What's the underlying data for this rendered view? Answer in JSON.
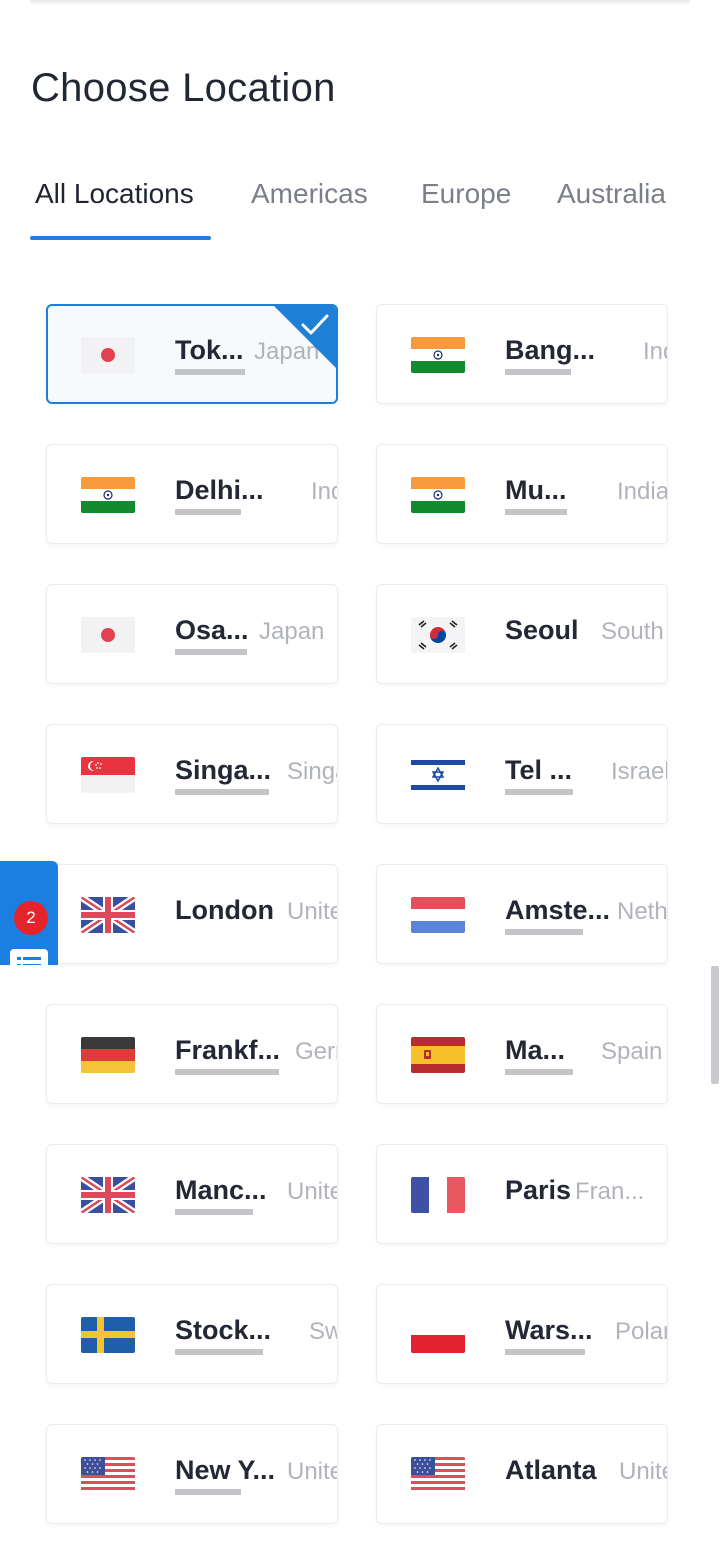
{
  "page": {
    "title": "Choose Location"
  },
  "tabs": [
    {
      "label": "All Locations",
      "active": true
    },
    {
      "label": "Americas",
      "active": false
    },
    {
      "label": "Europe",
      "active": false
    },
    {
      "label": "Australia",
      "active": false
    }
  ],
  "locations": [
    {
      "city": "Tok...",
      "country": "Japan",
      "flag": "japan-flag",
      "selected": true
    },
    {
      "city": "Bang...",
      "country": "India",
      "flag": "india-flag",
      "selected": false
    },
    {
      "city": "Delhi...",
      "country": "India",
      "flag": "india-flag",
      "selected": false
    },
    {
      "city": "Mu...",
      "country": "India",
      "flag": "india-flag",
      "selected": false
    },
    {
      "city": "Osa...",
      "country": "Japan",
      "flag": "japan-flag",
      "selected": false
    },
    {
      "city": "Seoul",
      "country": "South Korea",
      "flag": "south-korea-flag",
      "selected": false
    },
    {
      "city": "Singa...",
      "country": "Singapore",
      "flag": "singapore-flag",
      "selected": false
    },
    {
      "city": "Tel ...",
      "country": "Israel",
      "flag": "israel-flag",
      "selected": false
    },
    {
      "city": "London",
      "country": "United Kingdom",
      "flag": "uk-flag",
      "selected": false
    },
    {
      "city": "Amste...",
      "country": "Netherlands",
      "flag": "netherlands-flag",
      "selected": false
    },
    {
      "city": "Frankf...",
      "country": "Germany",
      "flag": "germany-flag",
      "selected": false
    },
    {
      "city": "Ma...",
      "country": "Spain",
      "flag": "spain-flag",
      "selected": false
    },
    {
      "city": "Manc...",
      "country": "United Kingdom",
      "flag": "uk-flag",
      "selected": false
    },
    {
      "city": "Paris",
      "country": "Fran...",
      "flag": "france-flag",
      "selected": false
    },
    {
      "city": "Stock...",
      "country": "Sweden",
      "flag": "sweden-flag",
      "selected": false
    },
    {
      "city": "Wars...",
      "country": "Poland",
      "flag": "poland-flag",
      "selected": false
    },
    {
      "city": "New Y...",
      "country": "United States",
      "flag": "usa-flag",
      "selected": false
    },
    {
      "city": "Atlanta",
      "country": "United States",
      "flag": "usa-flag",
      "selected": false
    }
  ],
  "side_widget": {
    "badge_count": "2",
    "icon": "list-icon"
  },
  "colors": {
    "accent": "#1d7fd6",
    "badge": "#e5232b",
    "widget": "#1a7fe1"
  }
}
